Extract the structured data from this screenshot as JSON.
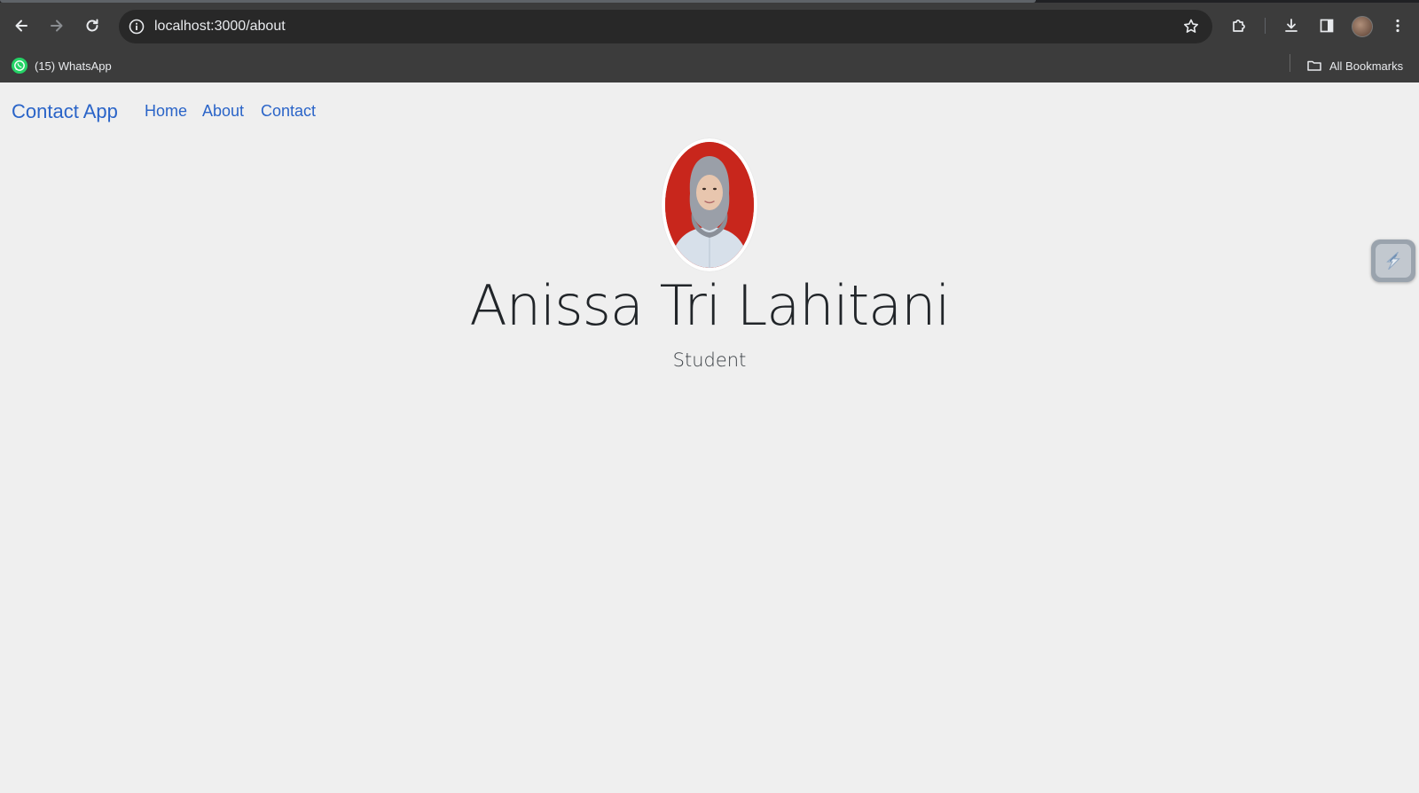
{
  "browser": {
    "url": "localhost:3000/about",
    "bookmarks": [
      {
        "label": "(15) WhatsApp",
        "icon": "whatsapp-icon"
      }
    ],
    "all_bookmarks_label": "All Bookmarks"
  },
  "navbar": {
    "brand": "Contact App",
    "links": [
      {
        "label": "Home"
      },
      {
        "label": "About"
      },
      {
        "label": "Contact"
      }
    ]
  },
  "profile": {
    "name": "Anissa Tri Lahitani",
    "role": "Student",
    "photo_icon": "profile-photo"
  },
  "colors": {
    "link": "#2a64c8",
    "page_bg": "#efefef",
    "chrome_bg": "#3c3c3c"
  }
}
